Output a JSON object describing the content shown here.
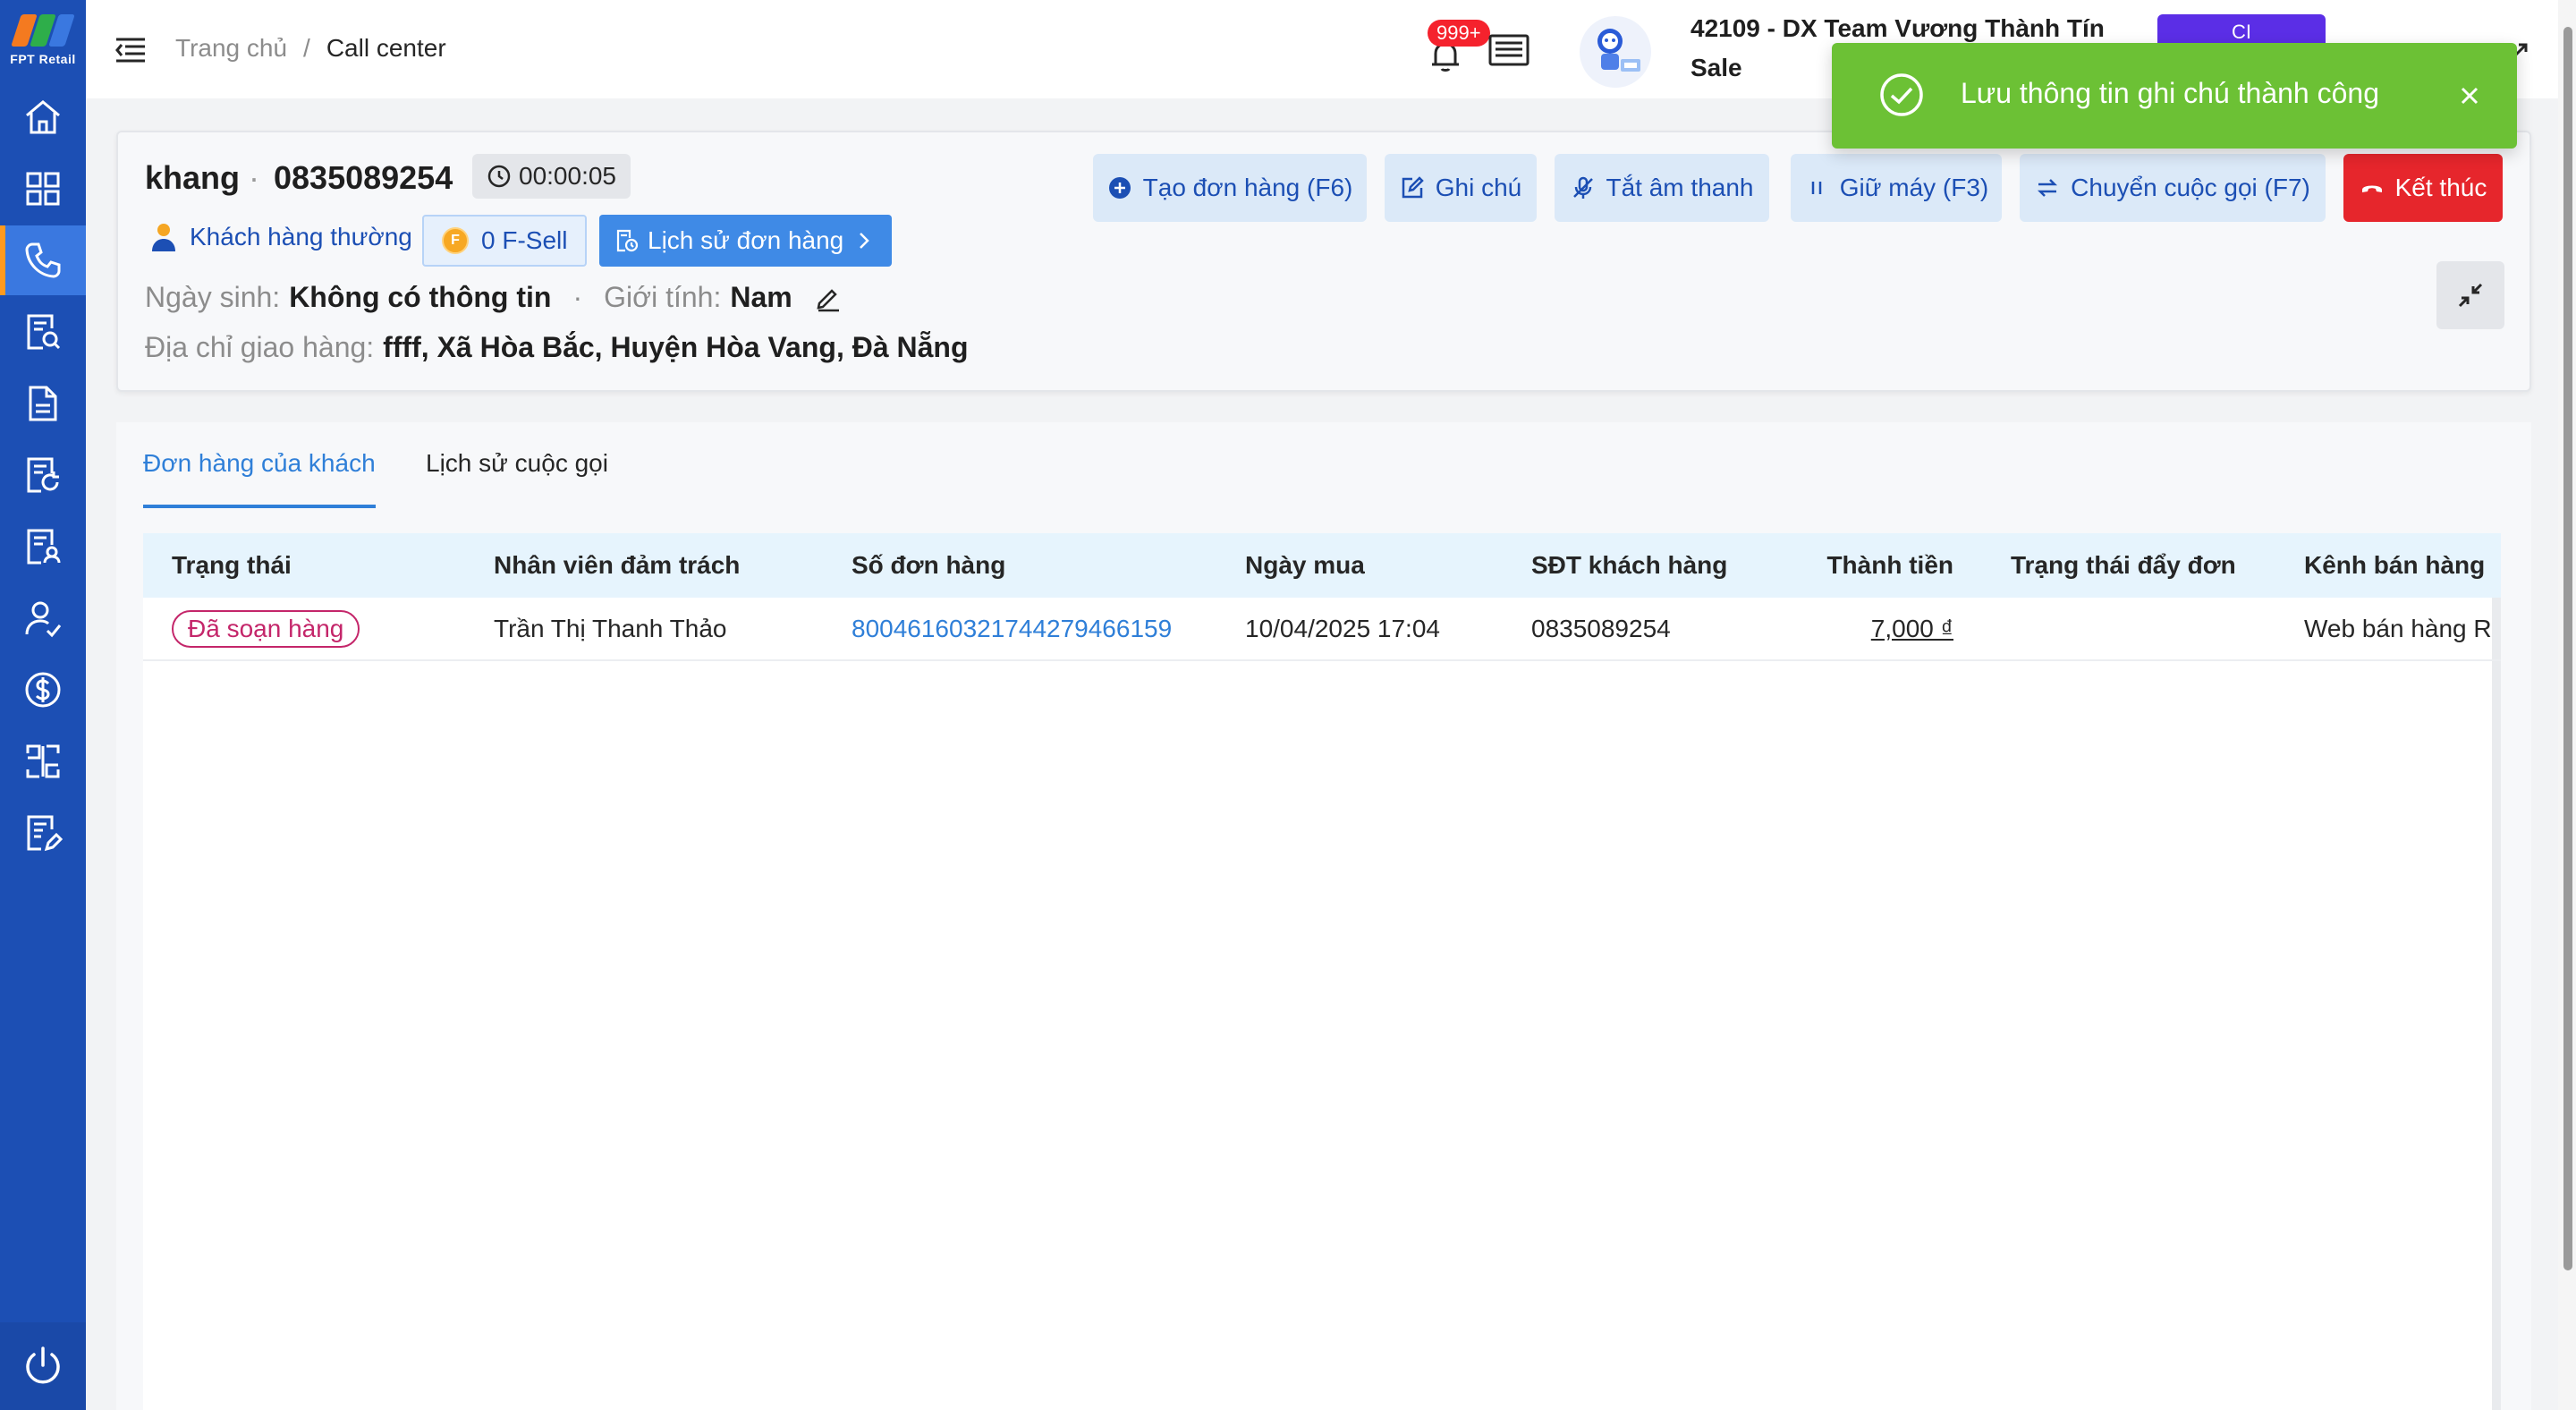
{
  "sidebar": {
    "logo_text": "FPT Retail",
    "logo_colors": [
      "#f47a20",
      "#2eae4a",
      "#3a78e0"
    ],
    "items": [
      {
        "icon": "home-icon",
        "active": false
      },
      {
        "icon": "grid-icon",
        "active": false
      },
      {
        "icon": "phone-icon",
        "active": true
      },
      {
        "icon": "document-search-icon",
        "active": false
      },
      {
        "icon": "document-icon",
        "active": false
      },
      {
        "icon": "document-refresh-icon",
        "active": false
      },
      {
        "icon": "document-user-icon",
        "active": false
      },
      {
        "icon": "user-check-icon",
        "active": false
      },
      {
        "icon": "dollar-circle-icon",
        "active": false
      },
      {
        "icon": "scan-icon",
        "active": false
      },
      {
        "icon": "document-edit-icon",
        "active": false
      }
    ],
    "power_icon": "power-icon"
  },
  "header": {
    "breadcrumb_home": "Trang chủ",
    "breadcrumb_sep": "/",
    "breadcrumb_current": "Call center",
    "notification_count": "999+",
    "user_name": "42109 - DX Team Vương Thành Tín",
    "user_role": "Sale",
    "ci_label": "CI"
  },
  "toast": {
    "message": "Lưu thông tin ghi chú thành công",
    "color": "#6cc135"
  },
  "call": {
    "customer_name": "khang",
    "separator": "·",
    "phone": "0835089254",
    "timer": "00:00:05",
    "customer_type": "Khách hàng thường",
    "fsell": "0 F-Sell",
    "fcoin_letter": "F",
    "order_history": "Lịch sử đơn hàng",
    "birthday_label": "Ngày sinh:",
    "birthday_value": "Không có thông tin",
    "dot": "·",
    "gender_label": "Giới tính:",
    "gender_value": "Nam",
    "address_label": "Địa chỉ giao hàng:",
    "address_value": "ffff, Xã Hòa Bắc, Huyện Hòa Vang, Đà Nẵng",
    "actions": {
      "create_order": "Tạo đơn hàng (F6)",
      "note": "Ghi chú",
      "mute": "Tắt âm thanh",
      "hold": "Giữ máy (F3)",
      "transfer": "Chuyển cuộc gọi (F7)",
      "end": "Kết thúc"
    }
  },
  "tabs": {
    "orders": "Đơn hàng của khách",
    "call_history": "Lịch sử cuộc gọi"
  },
  "table": {
    "columns": [
      "Trạng thái",
      "Nhân viên đảm trách",
      "Số đơn hàng",
      "Ngày mua",
      "SĐT khách hàng",
      "Thành tiền",
      "Trạng thái đẩy đơn",
      "Kênh bán hàng"
    ],
    "rows": [
      {
        "status": "Đã soạn hàng",
        "staff": "Trần Thị Thanh Thảo",
        "order_no": "80046160321744279466159",
        "date": "10/04/2025 17:04",
        "phone": "0835089254",
        "amount": "7,000 ₫",
        "push_status": "",
        "channel": "Web bán hàng R"
      }
    ]
  },
  "colors": {
    "sidebar": "#1c4fb4",
    "active_nav": "#3a78e0",
    "accent": "#2f7fd8",
    "end_call": "#e6262c",
    "status_tag": "#c4266a"
  }
}
